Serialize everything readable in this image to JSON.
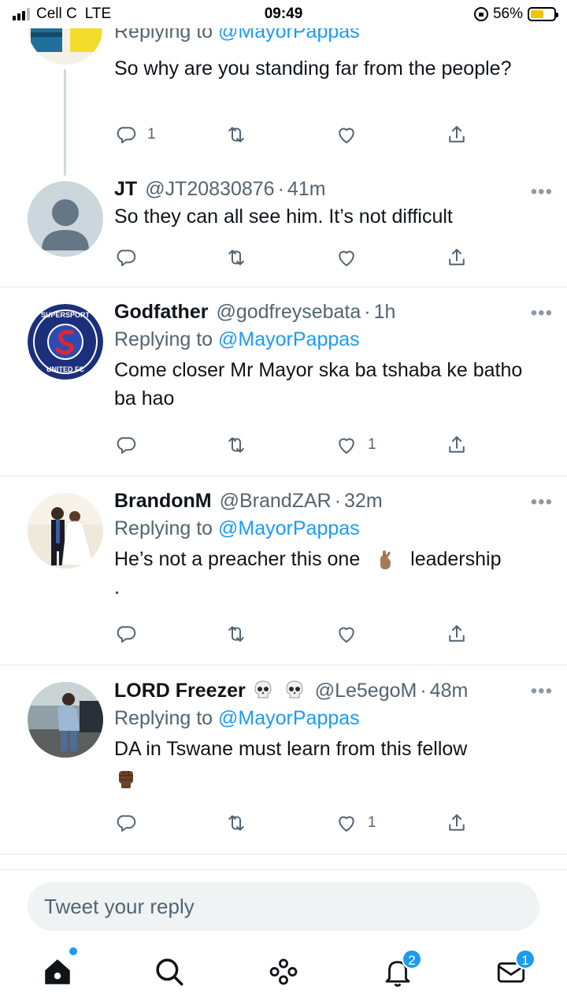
{
  "status_bar": {
    "carrier": "Cell C",
    "network": "LTE",
    "time": "09:49",
    "battery": "56%",
    "battery_level": 0.56,
    "battery_color": "#f2c300"
  },
  "colors": {
    "accent": "#1d9bf0",
    "secondary_text": "#536471"
  },
  "tweets": [
    {
      "replying_prefix": "Replying to",
      "mention": "@MayorPappas",
      "text": "So why are you standing far from the people?",
      "reply_count": "1",
      "retweet_count": "",
      "like_count": ""
    },
    {
      "name": "JT",
      "handle": "@JT20830876",
      "time": "41m",
      "text": "So they can all see him. It’s not difficult",
      "reply_count": "",
      "retweet_count": "",
      "like_count": ""
    },
    {
      "name": "Godfather",
      "handle": "@godfreysebata",
      "time": "1h",
      "replying_prefix": "Replying to",
      "mention": "@MayorPappas",
      "text": "Come closer Mr Mayor ska ba tshaba ke batho ba hao",
      "avatar_text_top": "SUPERSPORT",
      "avatar_text_bottom": "UNITED FC",
      "reply_count": "",
      "retweet_count": "",
      "like_count": "1"
    },
    {
      "name": "BrandonM",
      "handle": "@BrandZAR",
      "time": "32m",
      "replying_prefix": "Replying to",
      "mention": "@MayorPappas",
      "text_before": "He’s not a preacher this one",
      "text_after": "leadership",
      "text_line2": ".",
      "emoji": "crossed-fingers",
      "reply_count": "",
      "retweet_count": "",
      "like_count": ""
    },
    {
      "name": "LORD Freezer",
      "handle": "@Le5egoM",
      "time": "48m",
      "replying_prefix": "Replying to",
      "mention": "@MayorPappas",
      "text": "DA in Tswane must learn from this fellow",
      "name_emojis": [
        "skull",
        "skull"
      ],
      "text_emoji": "raised-fist",
      "reply_count": "",
      "retweet_count": "",
      "like_count": "1"
    }
  ],
  "reply_box": {
    "placeholder": "Tweet your reply"
  },
  "nav": {
    "notifications_badge": "2",
    "messages_badge": "1"
  }
}
